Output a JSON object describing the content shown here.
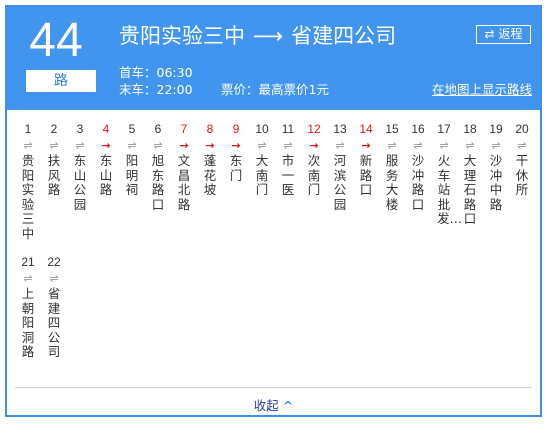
{
  "route": {
    "number": "44",
    "suffix": "路",
    "from": "贵阳实验三中",
    "arrow": "⟶",
    "to": "省建四公司"
  },
  "return_button": {
    "icon": "⇄",
    "label": "返程"
  },
  "first_bus": "首车：06:30",
  "last_bus": "末车：22:00",
  "fare": "票价：最高票价1元",
  "map_link": "在地图上显示路线",
  "stops": [
    {
      "num": "1",
      "name": "贵阳实验三中",
      "dir": "⇌",
      "oneway": false
    },
    {
      "num": "2",
      "name": "扶风路",
      "dir": "⇌",
      "oneway": false
    },
    {
      "num": "3",
      "name": "东山公园",
      "dir": "⇌",
      "oneway": false
    },
    {
      "num": "4",
      "name": "东山路",
      "dir": "→",
      "oneway": true
    },
    {
      "num": "5",
      "name": "阳明祠",
      "dir": "⇌",
      "oneway": false
    },
    {
      "num": "6",
      "name": "旭东路口",
      "dir": "⇌",
      "oneway": false
    },
    {
      "num": "7",
      "name": "文昌北路",
      "dir": "→",
      "oneway": true
    },
    {
      "num": "8",
      "name": "蓬花坡",
      "dir": "→",
      "oneway": true
    },
    {
      "num": "9",
      "name": "东门",
      "dir": "→",
      "oneway": true
    },
    {
      "num": "10",
      "name": "大南门",
      "dir": "⇌",
      "oneway": false
    },
    {
      "num": "11",
      "name": "市一医",
      "dir": "⇌",
      "oneway": false
    },
    {
      "num": "12",
      "name": "次南门",
      "dir": "→",
      "oneway": true
    },
    {
      "num": "13",
      "name": "河滨公园",
      "dir": "⇌",
      "oneway": false
    },
    {
      "num": "14",
      "name": "新路口",
      "dir": "→",
      "oneway": true
    },
    {
      "num": "15",
      "name": "服务大楼",
      "dir": "⇌",
      "oneway": false
    },
    {
      "num": "16",
      "name": "沙冲路口",
      "dir": "⇌",
      "oneway": false
    },
    {
      "num": "17",
      "name": "火车站批发…",
      "dir": "⇌",
      "oneway": false
    },
    {
      "num": "18",
      "name": "大理石路口",
      "dir": "⇌",
      "oneway": false
    },
    {
      "num": "19",
      "name": "沙冲中路",
      "dir": "⇌",
      "oneway": false
    },
    {
      "num": "20",
      "name": "干休所",
      "dir": "⇌",
      "oneway": false
    },
    {
      "num": "21",
      "name": "上朝阳洞路",
      "dir": "⇌",
      "oneway": false
    },
    {
      "num": "22",
      "name": "省建四公司",
      "dir": "⇌",
      "oneway": false
    }
  ],
  "collapse": {
    "label": "收起",
    "icon": "^"
  },
  "colors": {
    "header": "#4195ee",
    "oneway": "#e0161e",
    "link": "#2b3bb0"
  }
}
